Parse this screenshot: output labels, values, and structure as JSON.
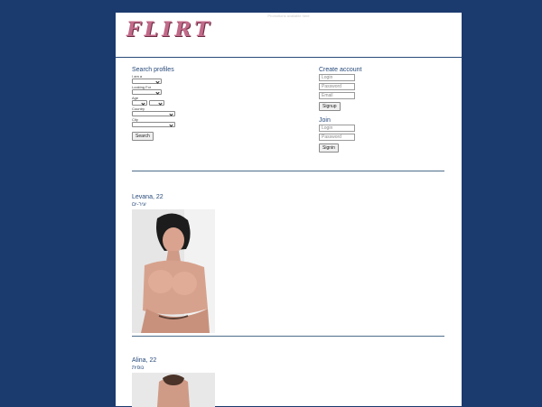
{
  "top_note": "Promotions available here",
  "logo": {
    "text": "FLIRT"
  },
  "search": {
    "title": "Search profiles",
    "i_am_label": "I am a",
    "looking_for_label": "Looking For",
    "age_label": "Age",
    "country_label": "Country",
    "city_label": "City",
    "button": "Search"
  },
  "create_account": {
    "title": "Create account",
    "login_placeholder": "Login",
    "password_placeholder": "Password",
    "email_placeholder": "Email",
    "button": "Signup"
  },
  "join": {
    "title": "Join",
    "login_placeholder": "Login",
    "password_placeholder": "Password",
    "button": "Signin"
  },
  "profiles": [
    {
      "name": "Levana, 22",
      "city": "עיר-ים"
    },
    {
      "name": "Alina, 22",
      "city": "נופית"
    }
  ],
  "colors": {
    "background": "#1b3a6e",
    "page": "#ffffff",
    "heading": "#274a7a",
    "logo": "#c26a8a"
  }
}
